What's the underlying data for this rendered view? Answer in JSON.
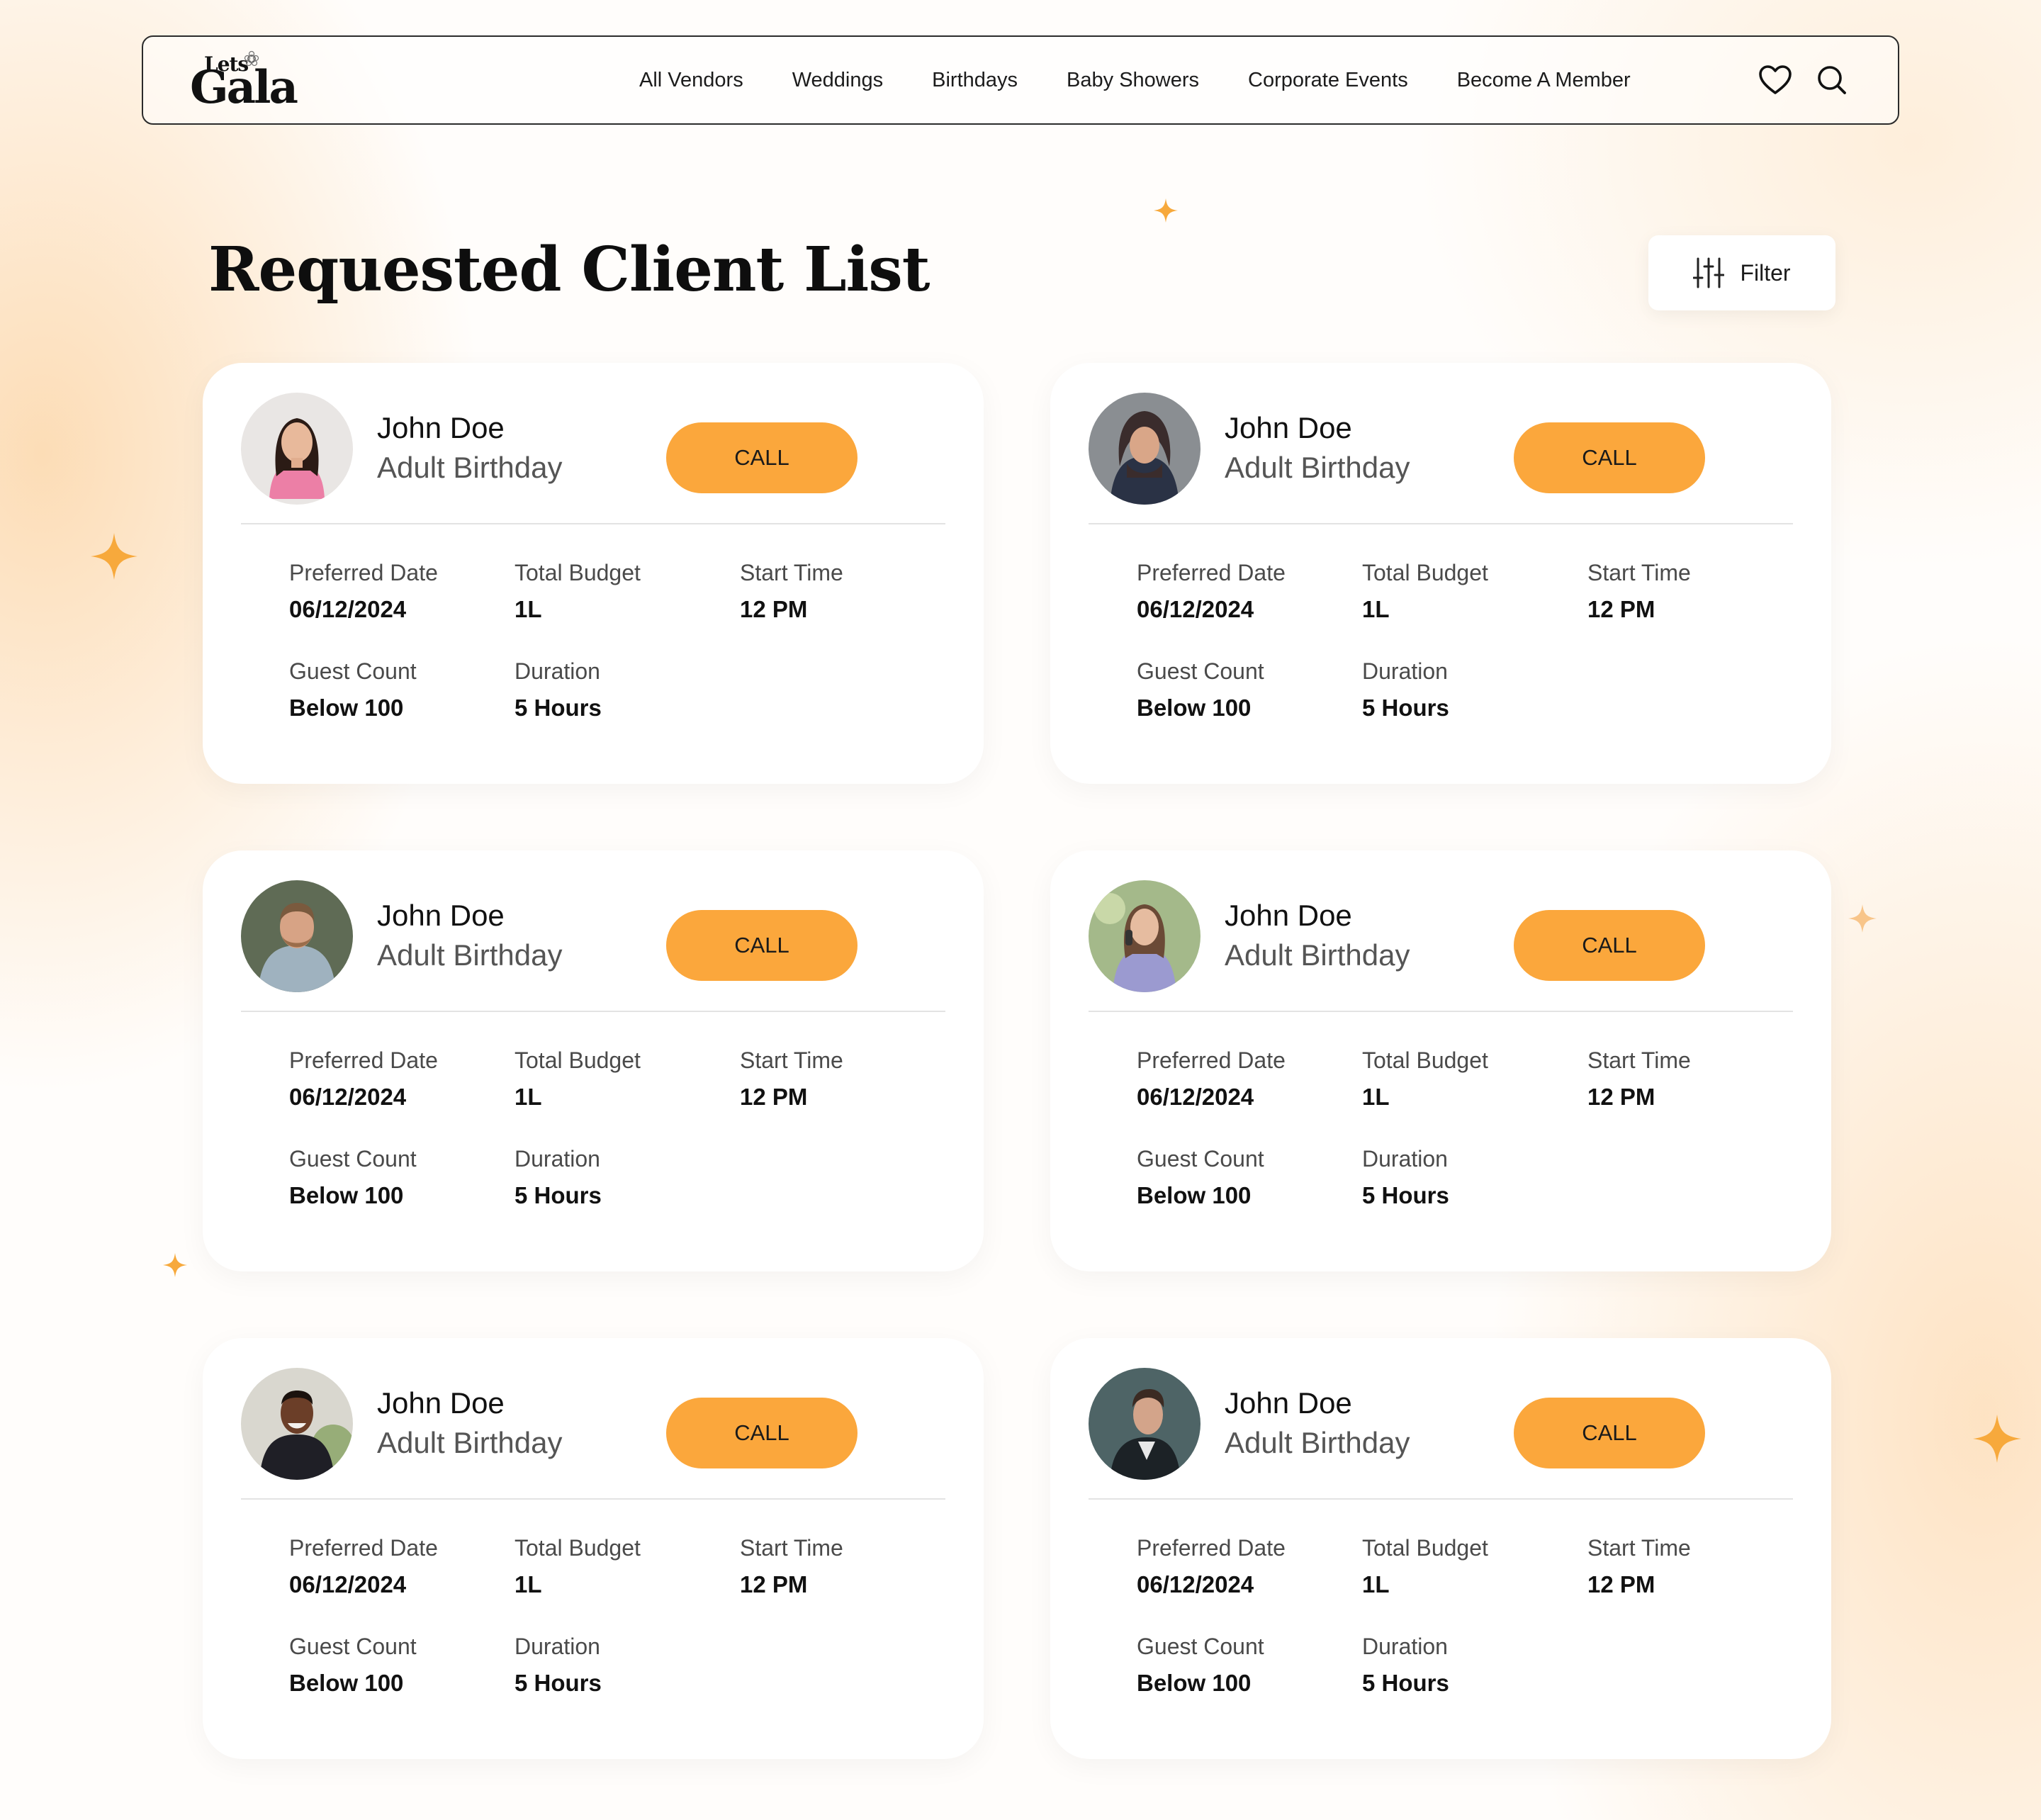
{
  "brand": {
    "logo_top": "Lets",
    "logo_main": "Gala"
  },
  "nav": {
    "links": [
      "All Vendors",
      "Weddings",
      "Birthdays",
      "Baby Showers",
      "Corporate Events",
      "Become A Member"
    ],
    "icons": [
      "heart-icon",
      "search-icon"
    ]
  },
  "page": {
    "title": "Requested Client List",
    "filter_label": "Filter"
  },
  "colors": {
    "accent": "#fba73c",
    "sparkle": "#f7a93c",
    "text": "#111111"
  },
  "field_labels": {
    "preferred_date": "Preferred Date",
    "total_budget": "Total Budget",
    "start_time": "Start Time",
    "guest_count": "Guest Count",
    "duration": "Duration"
  },
  "clients": [
    {
      "name": "John Doe",
      "event": "Adult Birthday",
      "call_label": "CALL",
      "preferred_date": "06/12/2024",
      "total_budget": "1L",
      "start_time": "12 PM",
      "guest_count": "Below 100",
      "duration": "5 Hours",
      "avatar": "woman-pink-sweater"
    },
    {
      "name": "John Doe",
      "event": "Adult Birthday",
      "call_label": "CALL",
      "preferred_date": "06/12/2024",
      "total_budget": "1L",
      "start_time": "12 PM",
      "guest_count": "Below 100",
      "duration": "5 Hours",
      "avatar": "woman-headscarf"
    },
    {
      "name": "John Doe",
      "event": "Adult Birthday",
      "call_label": "CALL",
      "preferred_date": "06/12/2024",
      "total_budget": "1L",
      "start_time": "12 PM",
      "guest_count": "Below 100",
      "duration": "5 Hours",
      "avatar": "man-hoodie"
    },
    {
      "name": "John Doe",
      "event": "Adult Birthday",
      "call_label": "CALL",
      "preferred_date": "06/12/2024",
      "total_budget": "1L",
      "start_time": "12 PM",
      "guest_count": "Below 100",
      "duration": "5 Hours",
      "avatar": "woman-phone"
    },
    {
      "name": "John Doe",
      "event": "Adult Birthday",
      "call_label": "CALL",
      "preferred_date": "06/12/2024",
      "total_budget": "1L",
      "start_time": "12 PM",
      "guest_count": "Below 100",
      "duration": "5 Hours",
      "avatar": "man-smiling"
    },
    {
      "name": "John Doe",
      "event": "Adult Birthday",
      "call_label": "CALL",
      "preferred_date": "06/12/2024",
      "total_budget": "1L",
      "start_time": "12 PM",
      "guest_count": "Below 100",
      "duration": "5 Hours",
      "avatar": "man-suit-profile"
    }
  ]
}
